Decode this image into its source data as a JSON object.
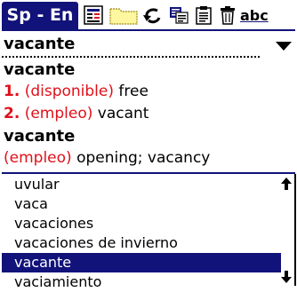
{
  "app": {
    "title": "Sp - En"
  },
  "toolbar": {
    "icons": [
      "details-icon",
      "folder-icon",
      "undo-icon",
      "dictionary-icon",
      "clipboard-icon",
      "trash-icon",
      "abc-icon"
    ],
    "abc_label": "abc"
  },
  "lookup": {
    "word": "vacante"
  },
  "entry": {
    "headword1": "vacante",
    "sense1_num": "1.",
    "sense1_label": "(disponible)",
    "sense1_text": "free",
    "sense2_num": "2.",
    "sense2_label": "(empleo)",
    "sense2_text": "vacant",
    "headword2": "vacante",
    "sense3_label": "(empleo)",
    "sense3_text": "opening; vacancy"
  },
  "wordlist": {
    "items": [
      "uvular",
      "vaca",
      "vacaciones",
      "vacaciones de invierno",
      "vacante",
      "vaciamiento"
    ],
    "selected": "vacante"
  },
  "colors": {
    "accent": "#11137a",
    "label_red": "#e0101a"
  }
}
